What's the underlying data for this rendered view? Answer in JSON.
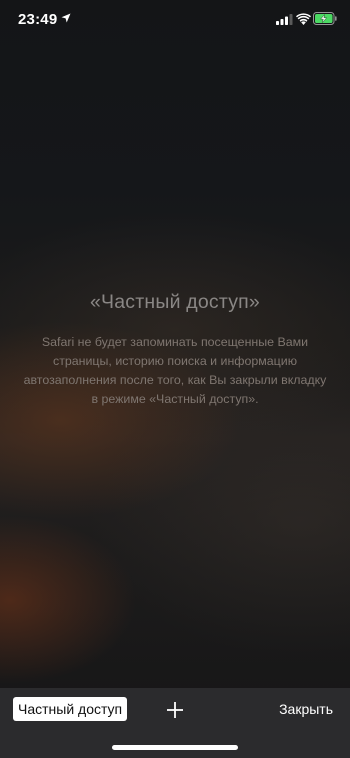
{
  "status_bar": {
    "time": "23:49"
  },
  "private_mode": {
    "title": "«Частный доступ»",
    "description": "Safari не будет запоминать посещенные Вами страницы, историю поиска и информацию автозаполнения после того, как Вы закрыли вкладку в режиме «Частный доступ»."
  },
  "toolbar": {
    "private_label": "Частный доступ",
    "close_label": "Закрыть"
  },
  "icons": {
    "location": "location-arrow-icon",
    "signal": "cellular-signal-icon",
    "wifi": "wifi-icon",
    "battery": "battery-charging-icon",
    "new_tab": "plus-icon"
  },
  "colors": {
    "battery_fill": "#4cd964",
    "toolbar_bg": "#2b2b2d"
  }
}
